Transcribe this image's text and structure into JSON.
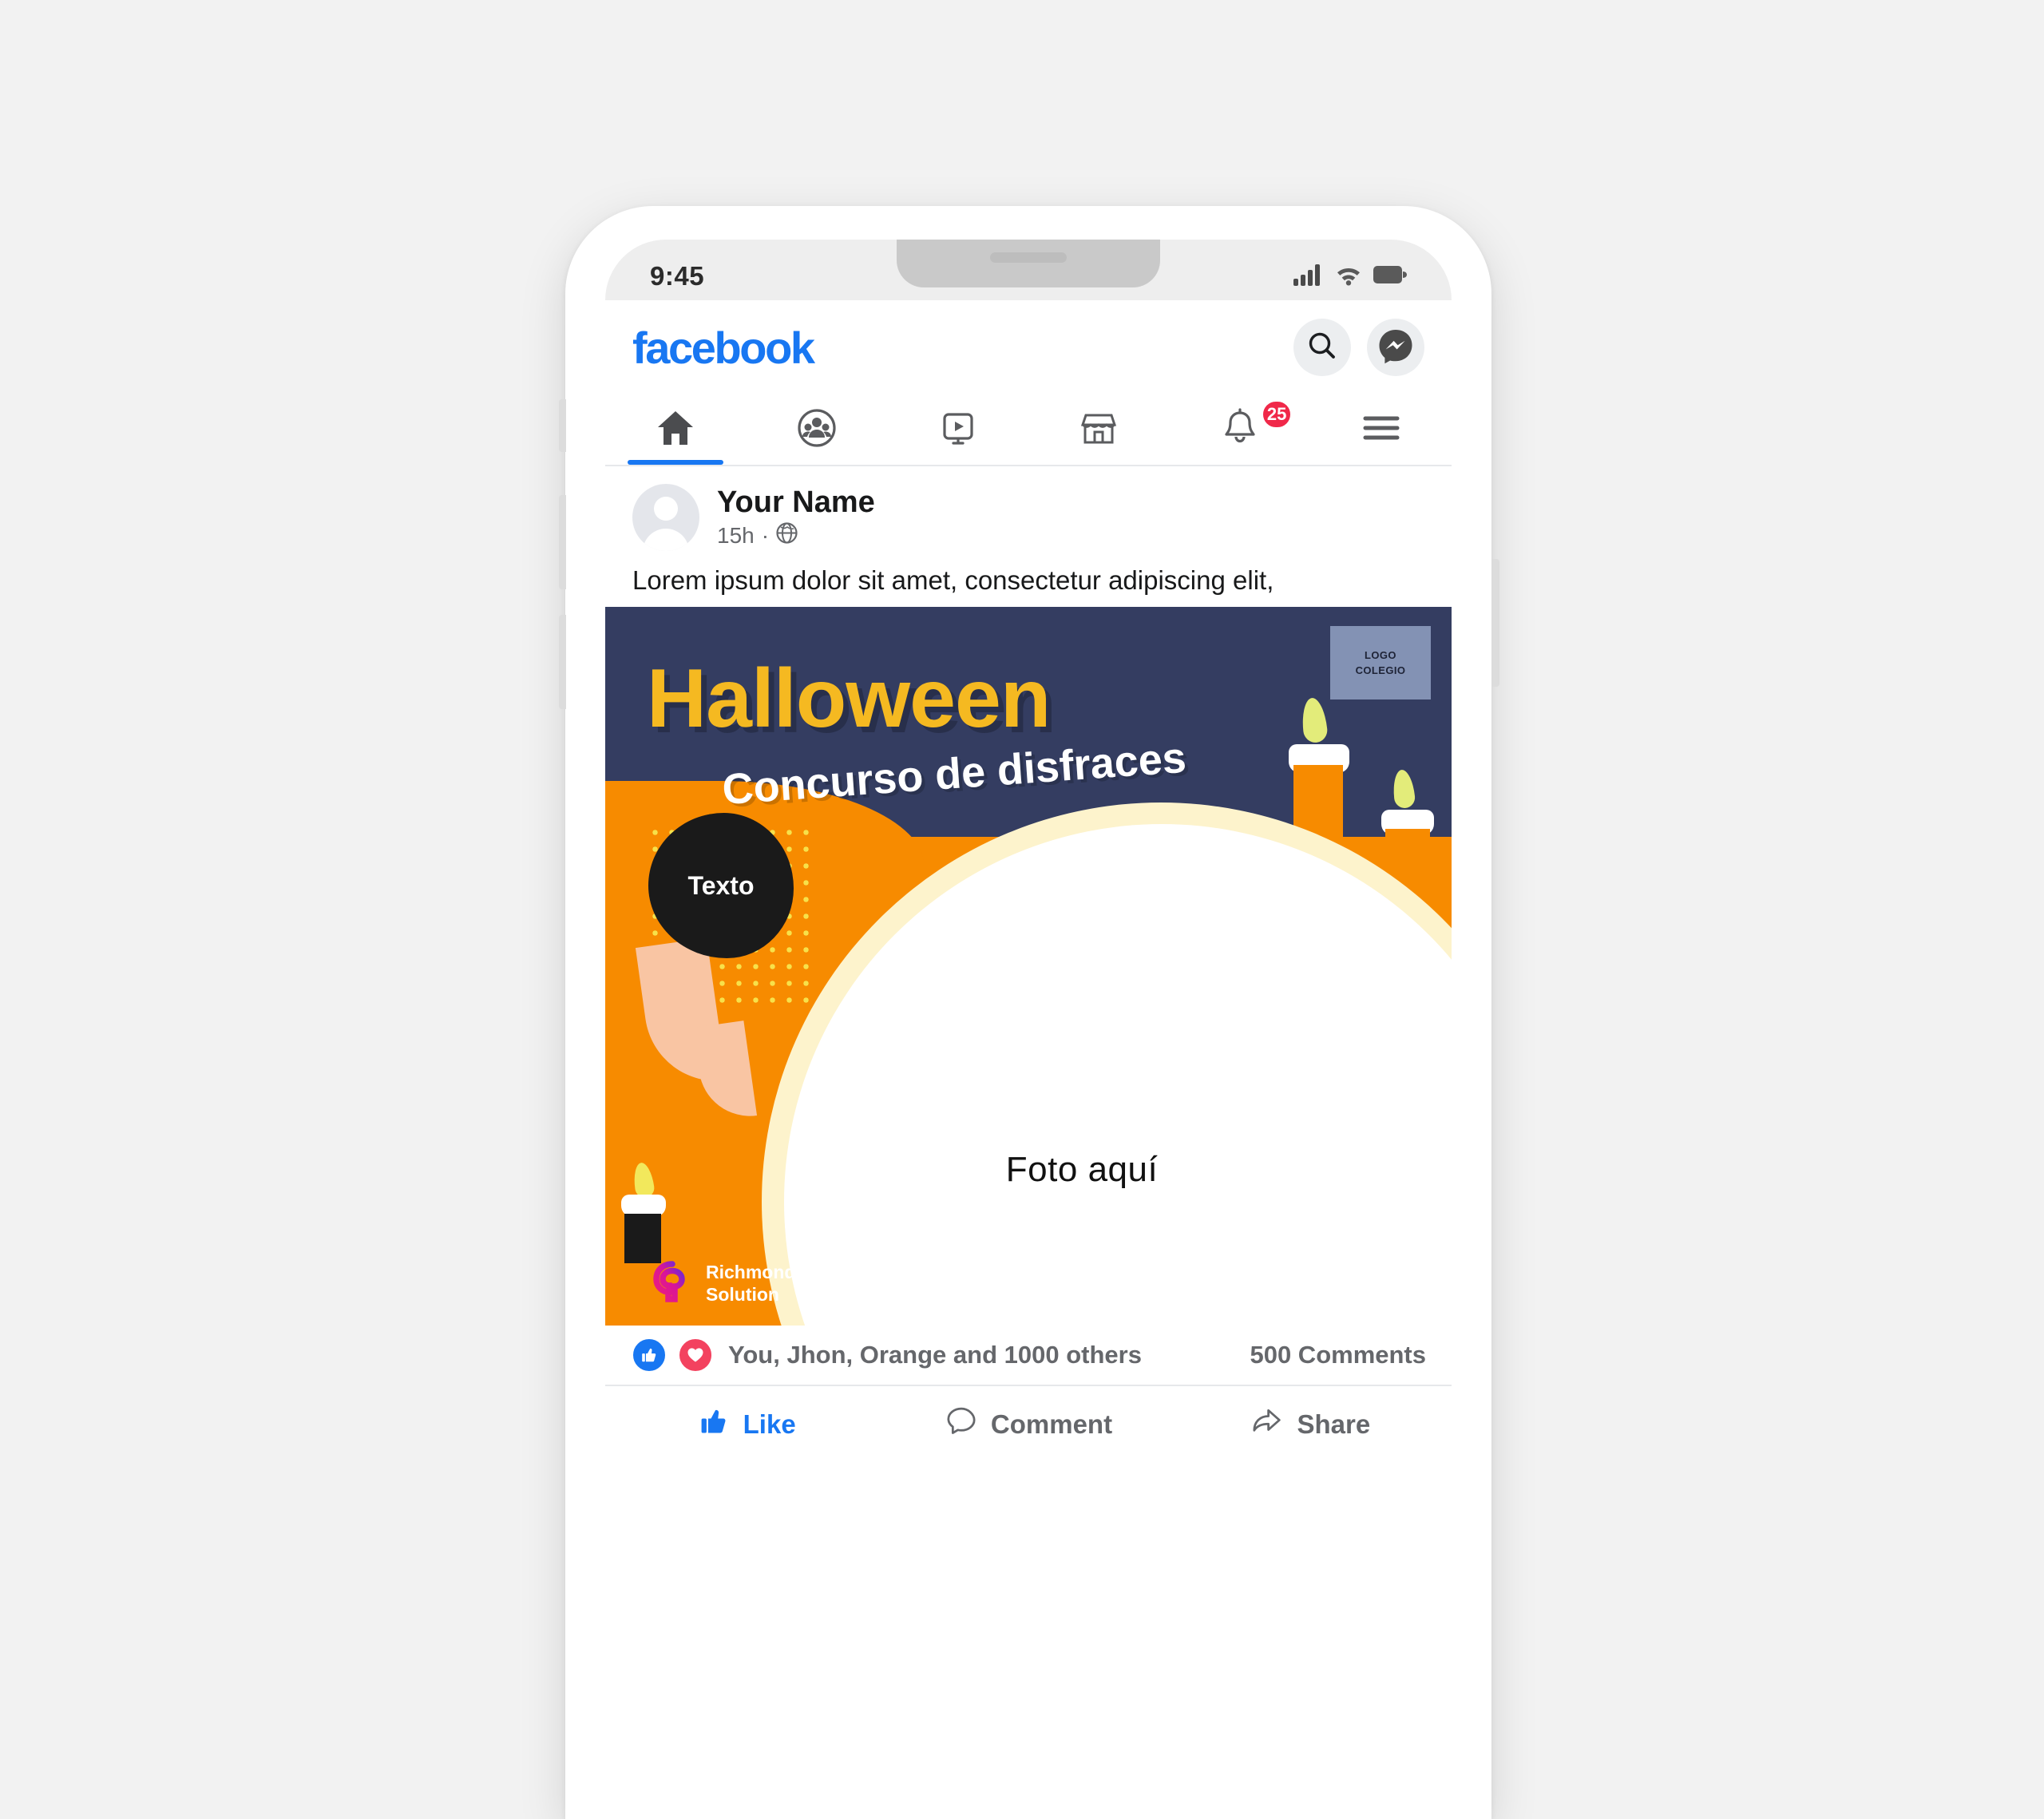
{
  "theme": {
    "fb_blue": "#1877f2",
    "badge_red": "#f02849",
    "banner_navy": "#343d61",
    "banner_orange": "#f78b00",
    "banner_yellow": "#f5b921",
    "cream": "#fdf3cc",
    "dot_yellow": "#f7e14a",
    "peach": "#f9c5a3",
    "flame_green": "#e3ec7a"
  },
  "statusbar": {
    "time": "9:45",
    "icons": [
      "signal-bars-icon",
      "wifi-icon",
      "battery-icon"
    ]
  },
  "header": {
    "logo": "facebook",
    "search_icon": "search-icon",
    "messenger_icon": "messenger-icon"
  },
  "nav": {
    "tabs": [
      {
        "name": "home",
        "icon": "home-icon",
        "active": true,
        "badge": ""
      },
      {
        "name": "friends",
        "icon": "friends-icon",
        "active": false,
        "badge": ""
      },
      {
        "name": "watch",
        "icon": "video-icon",
        "active": false,
        "badge": ""
      },
      {
        "name": "marketplace",
        "icon": "marketplace-icon",
        "active": false,
        "badge": ""
      },
      {
        "name": "notifications",
        "icon": "bell-icon",
        "active": false,
        "badge": "25"
      },
      {
        "name": "menu",
        "icon": "hamburger-icon",
        "active": false,
        "badge": ""
      }
    ],
    "notifications_badge": "25"
  },
  "post": {
    "author": "Your Name",
    "time": "15h",
    "separator": "·",
    "privacy_icon": "globe-icon",
    "text": "Lorem ipsum dolor sit amet, consectetur adipiscing elit,"
  },
  "banner": {
    "title": "Halloween",
    "subtitle": "Concurso de disfraces",
    "logo_placeholder_line1": "LOGO",
    "logo_placeholder_line2": "COLEGIO",
    "texto_blob": "Texto",
    "photo_placeholder": "Foto aquí",
    "brand_line1": "Richmond",
    "brand_line2": "Solution"
  },
  "engagement": {
    "like_icon": "thumbs-up-reaction-icon",
    "love_icon": "heart-reaction-icon",
    "reactions_text": "You, Jhon, Orange and 1000 others",
    "comments": "500 Comments"
  },
  "actions": [
    {
      "label": "Like",
      "icon": "thumbs-up-icon",
      "active": true
    },
    {
      "label": "Comment",
      "icon": "comment-bubble-icon",
      "active": false
    },
    {
      "label": "Share",
      "icon": "share-arrow-icon",
      "active": false
    }
  ]
}
